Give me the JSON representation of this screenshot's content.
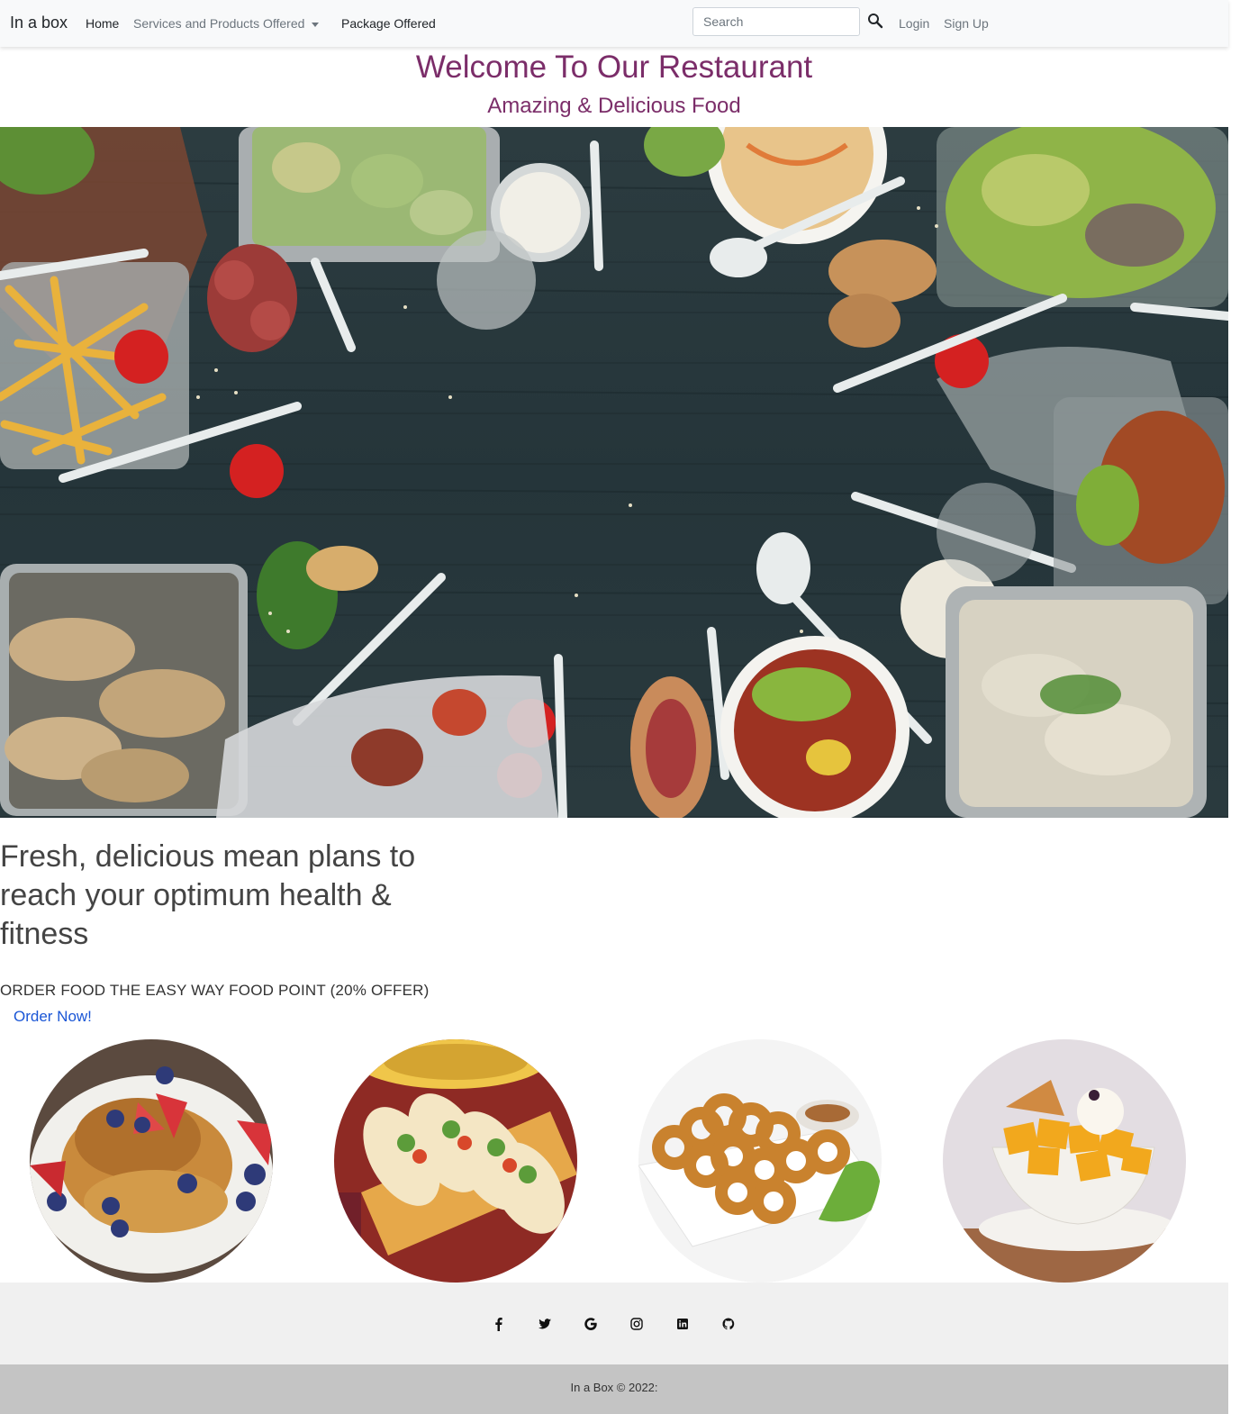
{
  "navbar": {
    "brand": "In a box",
    "links": {
      "home": "Home",
      "services": "Services and Products Offered",
      "package": "Package Offered",
      "login": "Login",
      "signup": "Sign Up"
    },
    "search_placeholder": "Search"
  },
  "hero": {
    "title": "Welcome To Our Restaurant",
    "subtitle": "Amazing & Delicious Food"
  },
  "intro": {
    "tagline": "Fresh, delicious mean plans to reach your optimum health & fitness",
    "offer": "ORDER FOOD THE EASY WAY FOOD POINT (20% OFFER)",
    "cta": "Order Now!"
  },
  "food_gallery": [
    "french-toast",
    "tacos",
    "onion-rings",
    "mango-dessert"
  ],
  "footer": {
    "social_icons": [
      "facebook-icon",
      "twitter-icon",
      "google-icon",
      "instagram-icon",
      "linkedin-icon",
      "github-icon"
    ],
    "copyright": "In a Box © 2022:"
  },
  "colors": {
    "heading_accent": "#7b2d69",
    "link_blue": "#1a56d6",
    "navbar_bg": "#f8f9fa",
    "footer_bg": "#f0f0f0",
    "copyright_bg": "#c4c4c4"
  }
}
